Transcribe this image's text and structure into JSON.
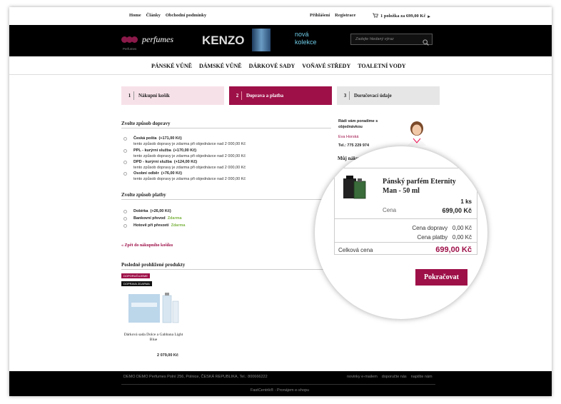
{
  "topbar": {
    "links_left": [
      "Home",
      "Články",
      "Obchodní podmínky"
    ],
    "links_right": [
      "Přihlášení",
      "Registrace"
    ],
    "cart": "1 položka za 699,00 Kč"
  },
  "header": {
    "logo_text": "perfumes",
    "logo_sub": "Perfumes",
    "banner_brand": "KENZO",
    "banner_line1": "nová",
    "banner_line2": "kolekce",
    "search_placeholder": "Zadejte hledaný výraz"
  },
  "nav": [
    "PÁNSKÉ VŮNĚ",
    "DÁMSKÉ VŮNĚ",
    "DÁRKOVÉ SADY",
    "VOŇAVÉ STŘEDY",
    "TOALETNÍ VODY"
  ],
  "steps": [
    {
      "num": "1",
      "label": "Nákupní košík"
    },
    {
      "num": "2",
      "label": "Doprava a platba"
    },
    {
      "num": "3",
      "label": "Doručovací údaje"
    }
  ],
  "shipping": {
    "title": "Zvolte způsob dopravy",
    "options": [
      {
        "label": "Česká pošta",
        "price": "(+171,00 Kč)",
        "note": "tento způsob dopravy je zdarma při objednávce nad 2 000,00 Kč"
      },
      {
        "label": "PPL - kurýrní služba",
        "price": "(+170,00 Kč)",
        "note": "tento způsob dopravy je zdarma při objednávce nad 2 000,00 Kč"
      },
      {
        "label": "DPD - kurýrní služba",
        "price": "(+124,00 Kč)",
        "note": "tento způsob dopravy je zdarma při objednávce nad 2 000,00 Kč"
      },
      {
        "label": "Osobní odběr",
        "price": "(+76,00 Kč)",
        "note": "tento způsob dopravy je zdarma při objednávce nad 2 000,00 Kč"
      }
    ]
  },
  "payment": {
    "title": "Zvolte způsob platby",
    "options": [
      {
        "label": "Dobírka",
        "price": "(+26,00 Kč)"
      },
      {
        "label": "Bankovní převod",
        "price": "Zdarma"
      },
      {
        "label": "Hotově při převzetí",
        "price": "Zdarma"
      }
    ]
  },
  "back_link": "« Zpět do nákupního košíku",
  "recent": {
    "title": "Posledně prohlížené produkty",
    "badge1": "DOPORUČUJEME",
    "badge2": "DOPRAVA ZDARMA",
    "product_name": "Dárková sada Dolce a Gabbana Light Blue",
    "product_price": "2 079,00 Kč"
  },
  "help": {
    "line1": "Rádi vám poradíme s",
    "line2": "objednávkou",
    "name": "Eva Horská",
    "phone": "Tel.: 775 229 974"
  },
  "summary": {
    "title": "Můj nákup",
    "product": "Pánský parfém Eternity Man - 50 ml",
    "qty": "1 ks",
    "price_label": "Cena",
    "price": "699,00 Kč",
    "shipping_label": "Cena dopravy",
    "shipping_value": "0,00 Kč",
    "payment_label": "Cena platby",
    "payment_value": "0,00 Kč",
    "total_label": "Celková cena",
    "total_value": "699,00 Kč"
  },
  "continue_label": "Pokračovat",
  "footer": {
    "address": "DEMO  DEMO Perfumes  Polní 256,  Polnice,  ČESKÁ REPUBLIKA,  Tel.: 800666222",
    "links": [
      "novinky e-mailem",
      "doporučte nás",
      "napište nám"
    ],
    "credit": "FastCentrik® - Pronájem e-shopu"
  },
  "colors": {
    "accent": "#9e1048",
    "step1": "#f7e1e9",
    "step3": "#e6e6e6",
    "free": "#7cb342"
  }
}
